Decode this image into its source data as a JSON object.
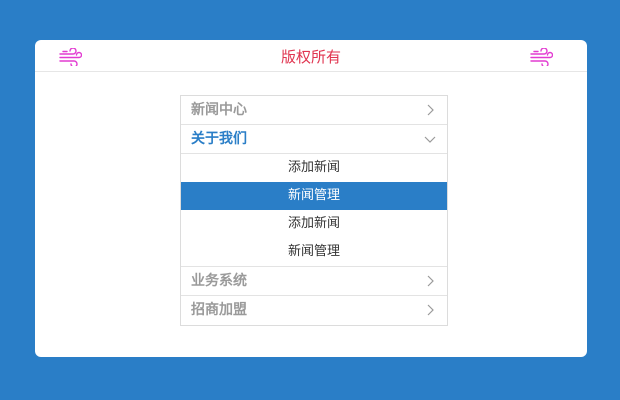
{
  "header": {
    "title": "版权所有",
    "left_icon": "wind-icon",
    "right_icon": "wind-icon",
    "icon_color": "#e23bd1",
    "title_color": "#e0344f"
  },
  "menu": {
    "items": [
      {
        "label": "新闻中心",
        "state": "collapsed",
        "icon": "chevron-right-icon"
      },
      {
        "label": "关于我们",
        "state": "expanded",
        "icon": "chevron-down-icon",
        "children": [
          {
            "label": "添加新闻",
            "active": false
          },
          {
            "label": "新闻管理",
            "active": true
          },
          {
            "label": "添加新闻",
            "active": false
          },
          {
            "label": "新闻管理",
            "active": false
          }
        ]
      },
      {
        "label": "业务系统",
        "state": "collapsed",
        "icon": "chevron-right-icon"
      },
      {
        "label": "招商加盟",
        "state": "collapsed",
        "icon": "chevron-right-icon"
      }
    ]
  },
  "colors": {
    "background": "#2a7ec7",
    "accent": "#2a7ec7",
    "card": "#ffffff"
  }
}
